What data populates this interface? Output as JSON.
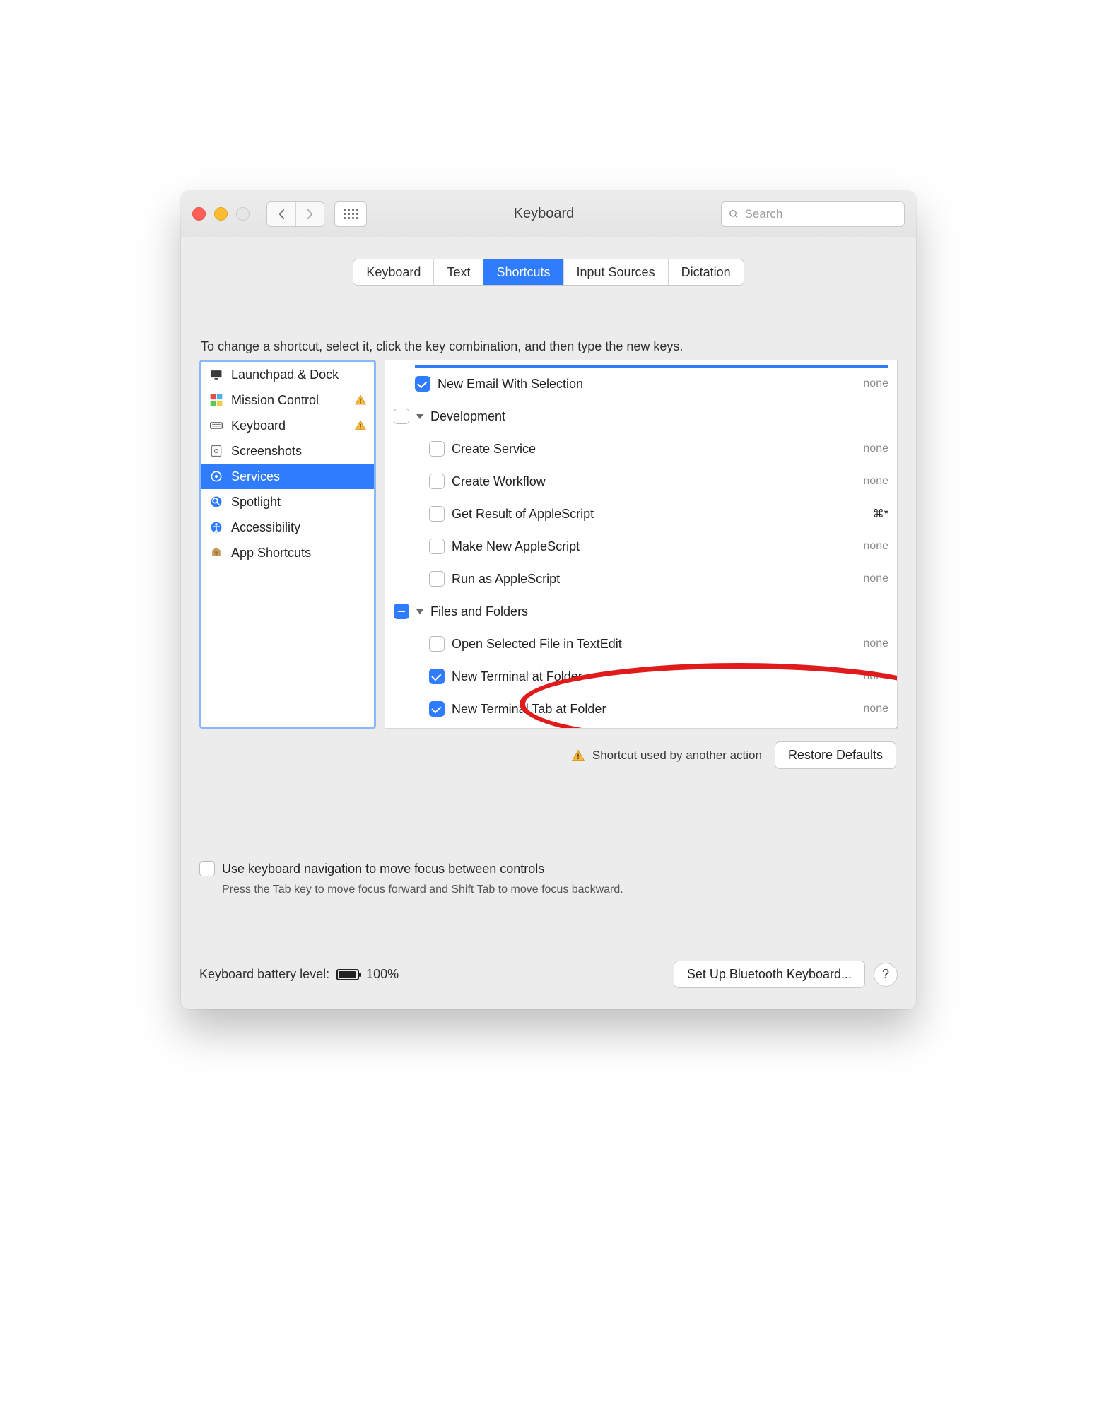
{
  "window": {
    "title": "Keyboard"
  },
  "toolbar": {
    "search_placeholder": "Search"
  },
  "tabs": [
    {
      "label": "Keyboard",
      "active": false
    },
    {
      "label": "Text",
      "active": false
    },
    {
      "label": "Shortcuts",
      "active": true
    },
    {
      "label": "Input Sources",
      "active": false
    },
    {
      "label": "Dictation",
      "active": false
    }
  ],
  "instruction": "To change a shortcut, select it, click the key combination, and then type the new keys.",
  "sidebar": {
    "items": [
      {
        "label": "Launchpad & Dock",
        "icon": "display",
        "warn": false
      },
      {
        "label": "Mission Control",
        "icon": "mission",
        "warn": true
      },
      {
        "label": "Keyboard",
        "icon": "keyboard",
        "warn": true
      },
      {
        "label": "Screenshots",
        "icon": "screenshot",
        "warn": false
      },
      {
        "label": "Services",
        "icon": "gear",
        "warn": false,
        "selected": true
      },
      {
        "label": "Spotlight",
        "icon": "spotlight",
        "warn": false
      },
      {
        "label": "Accessibility",
        "icon": "accessibility",
        "warn": false
      },
      {
        "label": "App Shortcuts",
        "icon": "app",
        "warn": false
      }
    ]
  },
  "services": {
    "rows": [
      {
        "type": "item",
        "checked": true,
        "label": "New Email With Selection",
        "shortcut": "none",
        "indent": 1
      },
      {
        "type": "group",
        "checked": false,
        "label": "Development"
      },
      {
        "type": "item",
        "checked": false,
        "label": "Create Service",
        "shortcut": "none",
        "indent": 2
      },
      {
        "type": "item",
        "checked": false,
        "label": "Create Workflow",
        "shortcut": "none",
        "indent": 2
      },
      {
        "type": "item",
        "checked": false,
        "label": "Get Result of AppleScript",
        "shortcut": "⌘*",
        "shortcut_key": true,
        "indent": 2
      },
      {
        "type": "item",
        "checked": false,
        "label": "Make New AppleScript",
        "shortcut": "none",
        "indent": 2
      },
      {
        "type": "item",
        "checked": false,
        "label": "Run as AppleScript",
        "shortcut": "none",
        "indent": 2
      },
      {
        "type": "group",
        "checked": "mixed",
        "label": "Files and Folders"
      },
      {
        "type": "item",
        "checked": false,
        "label": "Open Selected File in TextEdit",
        "shortcut": "none",
        "indent": 2
      },
      {
        "type": "item",
        "checked": true,
        "label": "New Terminal at Folder",
        "shortcut": "none",
        "indent": 2
      },
      {
        "type": "item",
        "checked": true,
        "label": "New Terminal Tab at Folder",
        "shortcut": "none",
        "indent": 2
      }
    ]
  },
  "hint_text": "Shortcut used by another action",
  "restore_button": "Restore Defaults",
  "nav_checkbox": {
    "label": "Use keyboard navigation to move focus between controls",
    "sub": "Press the Tab key to move focus forward and Shift Tab to move focus backward."
  },
  "footer": {
    "battery_label": "Keyboard battery level:",
    "battery_percent": "100%",
    "bluetooth_button": "Set Up Bluetooth Keyboard...",
    "help": "?"
  }
}
